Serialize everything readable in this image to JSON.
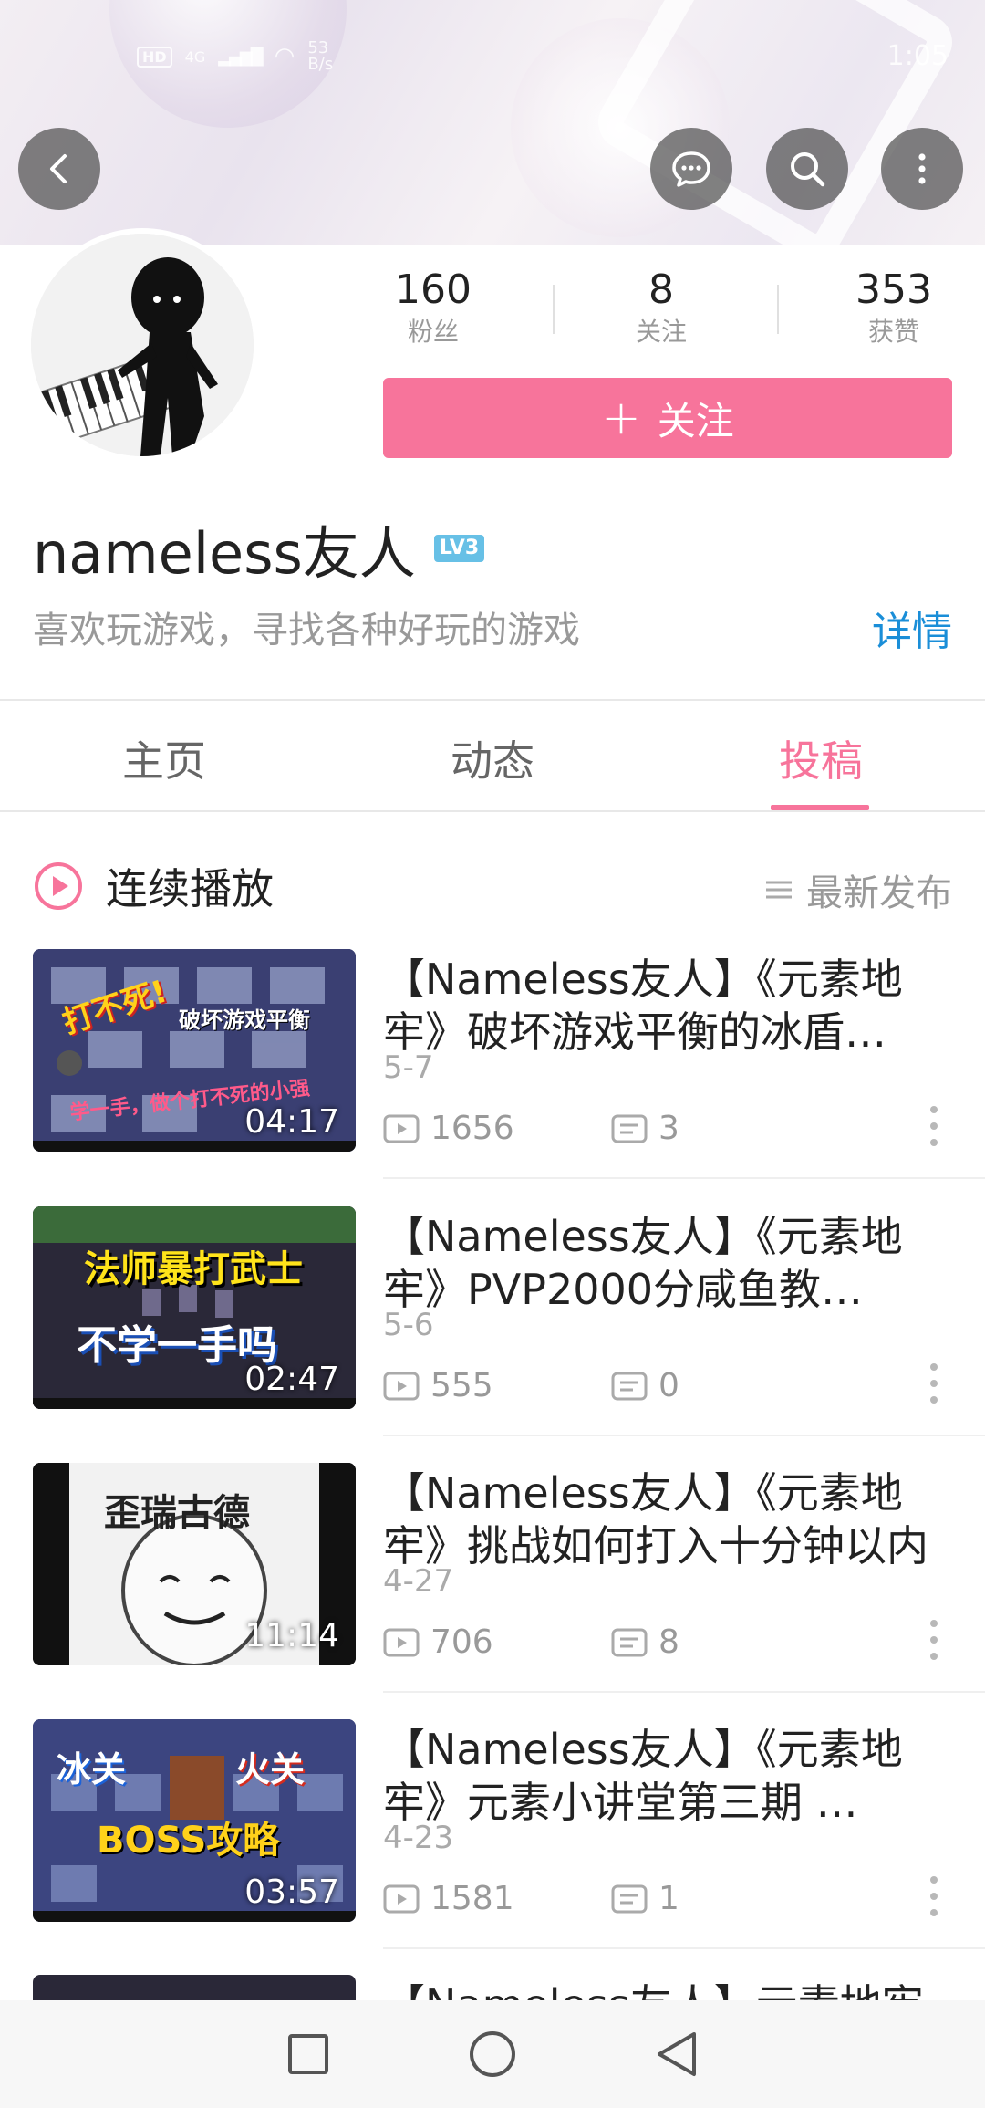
{
  "status_bar": {
    "hd": "HD",
    "network": "4G",
    "rate_value": "53",
    "rate_unit": "B/s",
    "time": "1:05"
  },
  "profile": {
    "username": "nameless友人",
    "level": "LV3",
    "bio": "喜欢玩游戏，寻找各种好玩的游戏",
    "detail_link": "详情",
    "follow_label": "关注",
    "stats": [
      {
        "value": "160",
        "label": "粉丝"
      },
      {
        "value": "8",
        "label": "关注"
      },
      {
        "value": "353",
        "label": "获赞"
      }
    ]
  },
  "tabs": [
    {
      "label": "主页",
      "active": false
    },
    {
      "label": "动态",
      "active": false
    },
    {
      "label": "投稿",
      "active": true
    }
  ],
  "controls": {
    "play_all": "连续播放",
    "sort": "最新发布"
  },
  "videos": [
    {
      "title": "【Nameless友人】《元素地牢》破坏游戏平衡的冰盾…",
      "date": "5-7",
      "views": "1656",
      "comments": "3",
      "duration": "04:17",
      "thumb_text": [
        "打不死!",
        "破坏游戏平衡",
        "学一手，做个打不死的小强"
      ]
    },
    {
      "title": "【Nameless友人】《元素地牢》PVP2000分咸鱼教…",
      "date": "5-6",
      "views": "555",
      "comments": "0",
      "duration": "02:47",
      "thumb_text": [
        "法师暴打武士",
        "不学一手吗"
      ]
    },
    {
      "title": "【Nameless友人】《元素地牢》挑战如何打入十分钟以内",
      "date": "4-27",
      "views": "706",
      "comments": "8",
      "duration": "11:14",
      "thumb_text": [
        "歪瑞古德"
      ]
    },
    {
      "title": "【Nameless友人】《元素地牢》元素小讲堂第三期 …",
      "date": "4-23",
      "views": "1581",
      "comments": "1",
      "duration": "03:57",
      "thumb_text": [
        "冰关",
        "火关",
        "BOSS攻略"
      ]
    },
    {
      "title": "【Nameless友人】元素地牢",
      "date": "",
      "views": "",
      "comments": "",
      "duration": "",
      "thumb_text": []
    }
  ],
  "colors": {
    "accent": "#f7749b",
    "link": "#1a8ed8",
    "level_badge": "#67c0e6"
  },
  "icons": [
    "back-icon",
    "message-icon",
    "search-icon",
    "more-vertical-icon",
    "play-circle-icon",
    "sort-list-icon",
    "play-count-icon",
    "comment-icon",
    "nav-recent-icon",
    "nav-home-icon",
    "nav-back-icon"
  ]
}
